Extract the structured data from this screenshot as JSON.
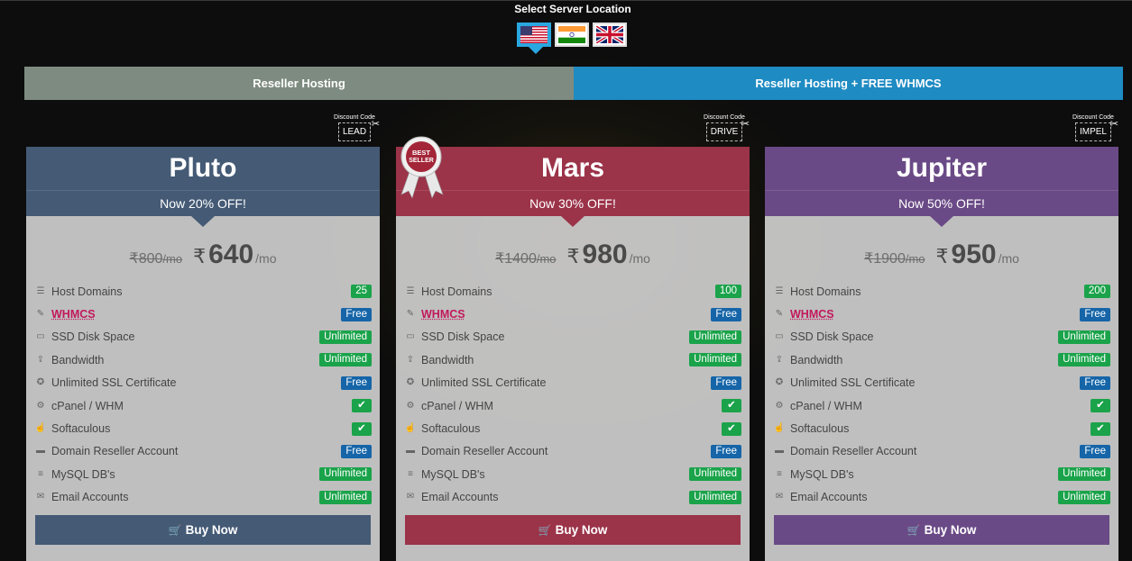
{
  "location": {
    "title": "Select Server Location",
    "flags": [
      {
        "name": "usa",
        "active": true
      },
      {
        "name": "india",
        "active": false
      },
      {
        "name": "uk",
        "active": false
      }
    ]
  },
  "tabs": [
    {
      "label": "Reseller Hosting",
      "active": true
    },
    {
      "label": "Reseller Hosting + FREE WHMCS",
      "active": false
    }
  ],
  "discount_label": "Discount Code",
  "currency_symbol": "₹",
  "per_month": "/mo",
  "buy_label": "Buy Now",
  "best_seller_text": "BEST SELLER",
  "plans": [
    {
      "name": "Pluto",
      "color": "#445a75",
      "offer": "Now 20% OFF!",
      "code": "LEAD",
      "old_price": "800",
      "price": "640",
      "features": [
        {
          "icon": "server-icon",
          "label": "Host Domains",
          "value": "25",
          "kind": "green"
        },
        {
          "icon": "edit-icon",
          "label": "WHMCS",
          "value": "Free",
          "kind": "blue",
          "highlight": true
        },
        {
          "icon": "hdd-icon",
          "label": "SSD Disk Space",
          "value": "Unlimited",
          "kind": "green"
        },
        {
          "icon": "upload-icon",
          "label": "Bandwidth",
          "value": "Unlimited",
          "kind": "green"
        },
        {
          "icon": "certificate-icon",
          "label": "Unlimited SSL Certificate",
          "value": "Free",
          "kind": "blue"
        },
        {
          "icon": "cogs-icon",
          "label": "cPanel / WHM",
          "value": "✔",
          "kind": "green"
        },
        {
          "icon": "hand-icon",
          "label": "Softaculous",
          "value": "✔",
          "kind": "green"
        },
        {
          "icon": "briefcase-icon",
          "label": "Domain Reseller Account",
          "value": "Free",
          "kind": "blue"
        },
        {
          "icon": "database-icon",
          "label": "MySQL DB's",
          "value": "Unlimited",
          "kind": "green"
        },
        {
          "icon": "envelope-icon",
          "label": "Email Accounts",
          "value": "Unlimited",
          "kind": "green"
        }
      ]
    },
    {
      "name": "Mars",
      "color": "#9b3349",
      "offer": "Now 30% OFF!",
      "code": "DRIVE",
      "old_price": "1400",
      "price": "980",
      "features": [
        {
          "icon": "server-icon",
          "label": "Host Domains",
          "value": "100",
          "kind": "green"
        },
        {
          "icon": "edit-icon",
          "label": "WHMCS",
          "value": "Free",
          "kind": "blue",
          "highlight": true
        },
        {
          "icon": "hdd-icon",
          "label": "SSD Disk Space",
          "value": "Unlimited",
          "kind": "green"
        },
        {
          "icon": "upload-icon",
          "label": "Bandwidth",
          "value": "Unlimited",
          "kind": "green"
        },
        {
          "icon": "certificate-icon",
          "label": "Unlimited SSL Certificate",
          "value": "Free",
          "kind": "blue"
        },
        {
          "icon": "cogs-icon",
          "label": "cPanel / WHM",
          "value": "✔",
          "kind": "green"
        },
        {
          "icon": "hand-icon",
          "label": "Softaculous",
          "value": "✔",
          "kind": "green"
        },
        {
          "icon": "briefcase-icon",
          "label": "Domain Reseller Account",
          "value": "Free",
          "kind": "blue"
        },
        {
          "icon": "database-icon",
          "label": "MySQL DB's",
          "value": "Unlimited",
          "kind": "green"
        },
        {
          "icon": "envelope-icon",
          "label": "Email Accounts",
          "value": "Unlimited",
          "kind": "green"
        }
      ]
    },
    {
      "name": "Jupiter",
      "color": "#6a4a86",
      "offer": "Now 50% OFF!",
      "code": "IMPEL",
      "old_price": "1900",
      "price": "950",
      "features": [
        {
          "icon": "server-icon",
          "label": "Host Domains",
          "value": "200",
          "kind": "green"
        },
        {
          "icon": "edit-icon",
          "label": "WHMCS",
          "value": "Free",
          "kind": "blue",
          "highlight": true
        },
        {
          "icon": "hdd-icon",
          "label": "SSD Disk Space",
          "value": "Unlimited",
          "kind": "green"
        },
        {
          "icon": "upload-icon",
          "label": "Bandwidth",
          "value": "Unlimited",
          "kind": "green"
        },
        {
          "icon": "certificate-icon",
          "label": "Unlimited SSL Certificate",
          "value": "Free",
          "kind": "blue"
        },
        {
          "icon": "cogs-icon",
          "label": "cPanel / WHM",
          "value": "✔",
          "kind": "green"
        },
        {
          "icon": "hand-icon",
          "label": "Softaculous",
          "value": "✔",
          "kind": "green"
        },
        {
          "icon": "briefcase-icon",
          "label": "Domain Reseller Account",
          "value": "Free",
          "kind": "blue"
        },
        {
          "icon": "database-icon",
          "label": "MySQL DB's",
          "value": "Unlimited",
          "kind": "green"
        },
        {
          "icon": "envelope-icon",
          "label": "Email Accounts",
          "value": "Unlimited",
          "kind": "green"
        }
      ]
    }
  ]
}
